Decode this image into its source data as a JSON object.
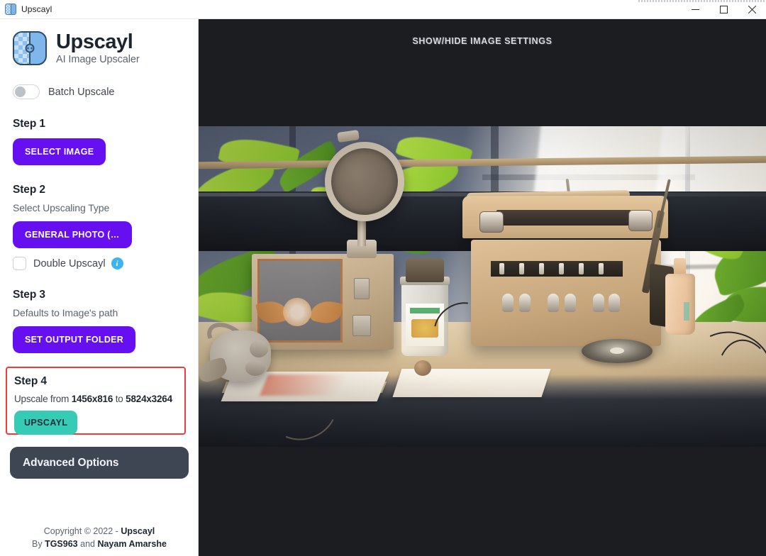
{
  "titlebar": {
    "app_icon": "upscayl-app-icon",
    "title": "Upscayl",
    "minimize_label": "—",
    "maximize_label": "☐",
    "close_label": "✕"
  },
  "sidebar": {
    "brand": {
      "name": "Upscayl",
      "tagline": "AI Image Upscaler",
      "logo_icon": "upscayl-logo-icon"
    },
    "batch": {
      "label": "Batch Upscale",
      "enabled": false
    },
    "step1": {
      "heading": "Step 1",
      "select_image_label": "SELECT IMAGE"
    },
    "step2": {
      "heading": "Step 2",
      "subtitle": "Select Upscaling Type",
      "model_label": "GENERAL PHOTO (…",
      "double_upscayl_label": "Double Upscayl",
      "double_upscayl_checked": false,
      "info_icon": "info-icon",
      "info_glyph": "i"
    },
    "step3": {
      "heading": "Step 3",
      "subtitle": "Defaults to Image's path",
      "set_output_folder_label": "SET OUTPUT FOLDER"
    },
    "step4": {
      "heading": "Step 4",
      "upscale_prefix": "Upscale from",
      "source_resolution": "1456x816",
      "upscale_middle": "to",
      "target_resolution": "5824x3264",
      "upscayl_button_label": "UPSCAYL",
      "highlight_color": "#ef3b3b"
    },
    "advanced_options_label": "Advanced Options",
    "footer": {
      "line1_prefix": "Copyright © 2022 - ",
      "line1_bold": "Upscayl",
      "line2_prefix": "By ",
      "line2_bold1": "TGS963",
      "line2_middle": " and ",
      "line2_bold2": "Nayam Amarshe"
    }
  },
  "viewer": {
    "settings_toggle_label": "SHOW/HIDE IMAGE SETTINGS",
    "background_color": "#1c1d21",
    "image_alt": "vintage radio and microphone on a sunlit wooden desk with plants"
  },
  "theme": {
    "purple": "#6610f2",
    "teal": "#35cbb5",
    "dark_slate": "#3e4654",
    "info_blue": "#3cb4ef",
    "red_highlight": "#ef3b3b"
  }
}
